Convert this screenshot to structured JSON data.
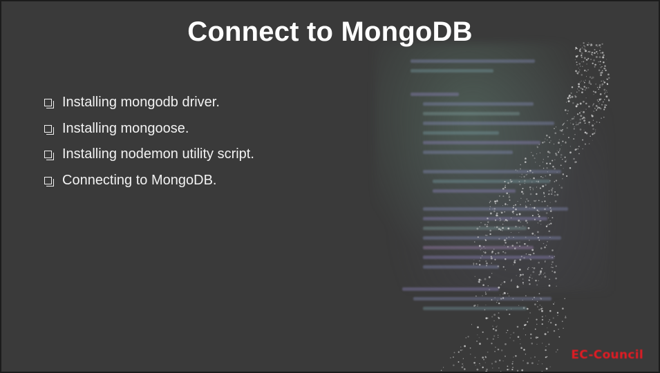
{
  "slide": {
    "title": "Connect to MongoDB",
    "bullets": [
      "Installing mongodb driver.",
      "Installing mongoose.",
      "Installing nodemon utility script.",
      "Connecting to MongoDB."
    ],
    "bullet_icon": "square-checkbox-icon",
    "logo_text": "EC-Council"
  },
  "colors": {
    "background": "#3a3a3a",
    "title": "#ffffff",
    "text": "#f2f2f2",
    "logo": "#e31b23"
  }
}
